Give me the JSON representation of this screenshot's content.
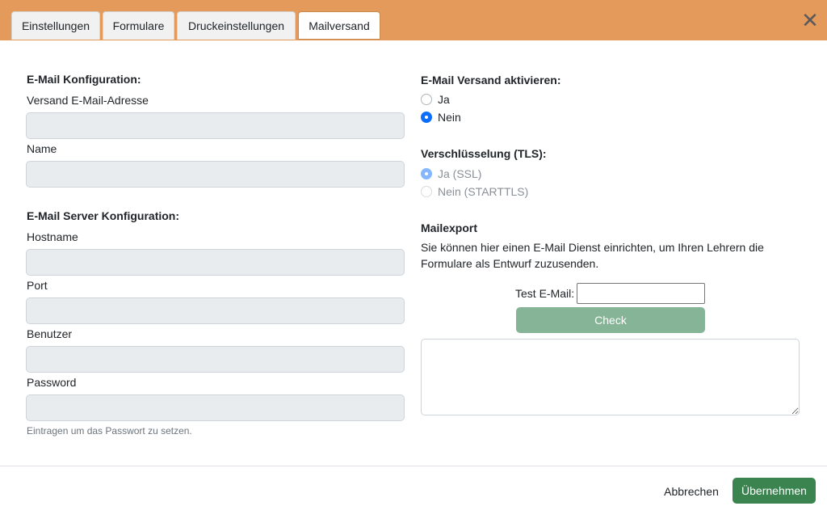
{
  "tabs": [
    {
      "label": "Einstellungen",
      "active": false
    },
    {
      "label": "Formulare",
      "active": false
    },
    {
      "label": "Druckeinstellungen",
      "active": false
    },
    {
      "label": "Mailversand",
      "active": true
    }
  ],
  "header": {
    "close_icon": "close-icon",
    "close_glyph": "✕",
    "color": "#e49a5b"
  },
  "left": {
    "email_config_heading": "E-Mail Konfiguration:",
    "sender_address_label": "Versand E-Mail-Adresse",
    "sender_address_value": "",
    "name_label": "Name",
    "name_value": "",
    "server_config_heading": "E-Mail Server Konfiguration:",
    "hostname_label": "Hostname",
    "hostname_value": "",
    "port_label": "Port",
    "port_value": "",
    "user_label": "Benutzer",
    "user_value": "",
    "password_label": "Password",
    "password_value": "",
    "password_hint": "Eintragen um das Passwort zu setzen."
  },
  "right": {
    "activate_heading": "E-Mail Versand aktivieren:",
    "activate_options": [
      {
        "label": "Ja",
        "checked": false
      },
      {
        "label": "Nein",
        "checked": true
      }
    ],
    "tls_heading": "Verschlüsselung (TLS):",
    "tls_options": [
      {
        "label": "Ja (SSL)",
        "checked": true,
        "disabled": true
      },
      {
        "label": "Nein (STARTTLS)",
        "checked": false,
        "disabled": true
      }
    ],
    "mailexport_heading": "Mailexport",
    "mailexport_text": "Sie können hier einen E-Mail Dienst einrichten, um Ihren Lehrern die Formulare als Entwurf zuzusenden.",
    "test_email_label": "Test E-Mail:",
    "test_email_value": "",
    "check_label": "Check",
    "result_text": ""
  },
  "footer": {
    "cancel_label": "Abbrechen",
    "apply_label": "Übernehmen"
  },
  "colors": {
    "header": "#e49a5b",
    "check_button": "#86b497",
    "apply_button": "#3b8450",
    "radio_checked": "#0d6efd"
  }
}
